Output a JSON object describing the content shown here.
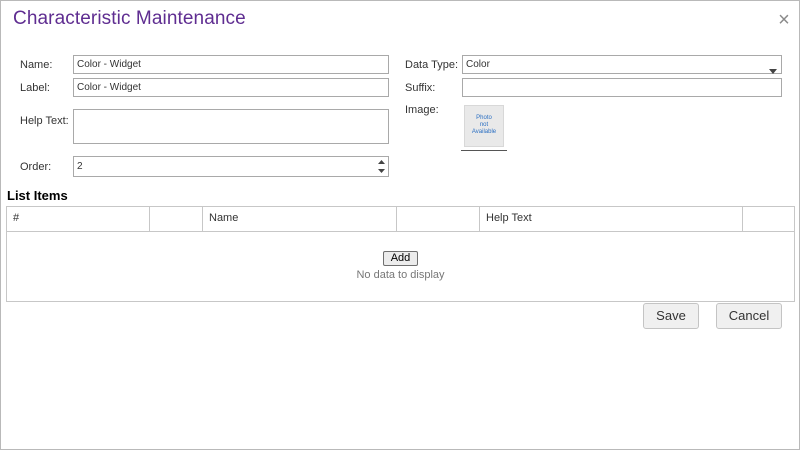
{
  "dialog": {
    "title": "Characteristic Maintenance",
    "close_icon": "close-icon"
  },
  "form": {
    "name_label": "Name:",
    "name_value": "Color - Widget",
    "label_label": "Label:",
    "label_value": "Color - Widget",
    "help_text_label": "Help Text:",
    "help_text_value": "",
    "order_label": "Order:",
    "order_value": "2",
    "data_type_label": "Data Type:",
    "data_type_value": "Color",
    "suffix_label": "Suffix:",
    "suffix_value": "",
    "image_label": "Image:",
    "image_placeholder": {
      "line1": "Photo",
      "line2": "not",
      "line3": "Available"
    }
  },
  "list_items": {
    "section_title": "List Items",
    "columns": [
      "#",
      "",
      "Name",
      "",
      "Help Text",
      ""
    ],
    "add_label": "Add",
    "empty_text": "No data to display"
  },
  "footer": {
    "save_label": "Save",
    "cancel_label": "Cancel"
  },
  "colors": {
    "title": "#5f2d91",
    "border": "#a9a9a9",
    "photo_text": "#2b6fc2"
  }
}
